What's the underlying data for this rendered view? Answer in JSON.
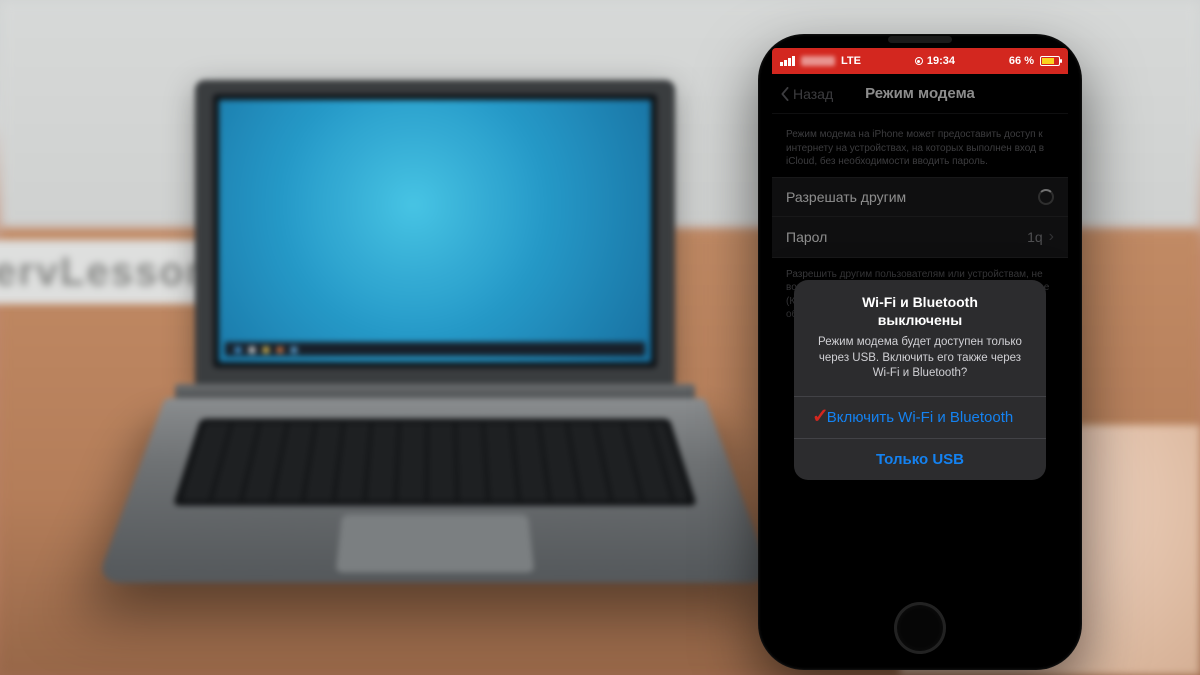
{
  "background_logo": "ervLesson",
  "statusbar": {
    "network": "LTE",
    "time": "19:34",
    "battery": "66 %"
  },
  "nav": {
    "back": "Назад",
    "title": "Режим модема"
  },
  "sections": {
    "intro": "Режим модема на iPhone может предоставить доступ к интернету на устройствах, на которых выполнен вход в iCloud, без необходимости вводить пароль.",
    "allow_others_label": "Разрешать другим",
    "password_label": "Парол",
    "password_value": "1q",
    "footer": "Разрешить другим пользователям или устройствам, не вошедшим в iCloud, подключаться к общей сети «iPhone (Константин)» в режиме модема. Режим модема будет обнаруживаться без подключения."
  },
  "alert": {
    "title_l1": "Wi-Fi и Bluetooth",
    "title_l2": "выключены",
    "message": "Режим модема будет доступен только через USB. Включить его также через Wi-Fi и Bluetooth?",
    "primary": "Включить Wi-Fi и Bluetooth",
    "secondary": "Только USB"
  }
}
